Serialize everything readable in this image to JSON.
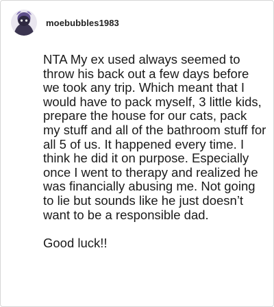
{
  "comment": {
    "username": "moebubbles1983",
    "avatar_icon": "cartoon-character-avatar",
    "paragraphs": [
      "NTA My ex used always seemed to throw his back out a few days before we took any trip. Which meant that I would have to pack myself, 3 little kids, prepare the house for our cats, pack my stuff and all of the bathroom stuff for all 5 of us. It happened every time. I think he did it on purpose. Especially once I went to therapy and realized he was financially abusing me. Not going to lie but sounds like he just doesn’t want to be a responsible dad.",
      "Good luck!!"
    ]
  }
}
